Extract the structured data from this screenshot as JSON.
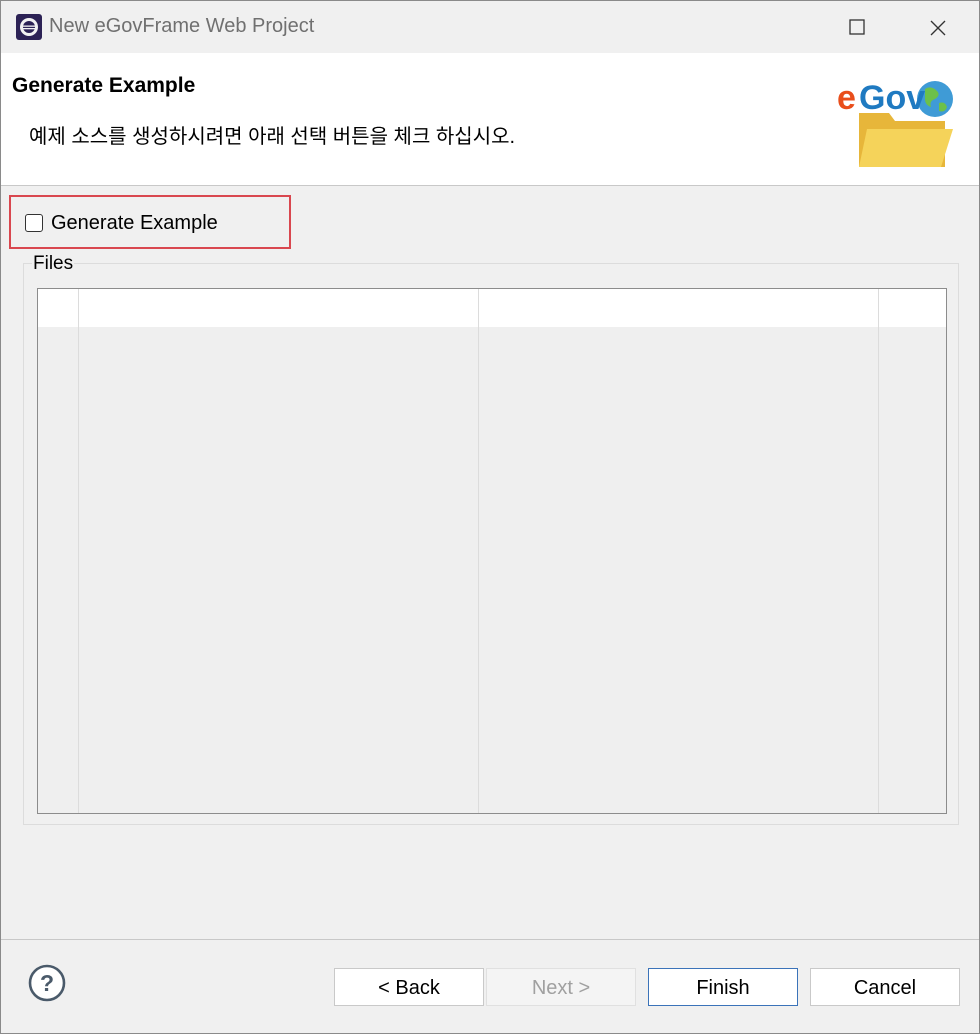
{
  "window": {
    "title": "New eGovFrame Web Project"
  },
  "header": {
    "title": "Generate Example",
    "description": "예제 소스를 생성하시려면 아래 선택 버튼을 체크 하십시오.",
    "logo_text": "eGov"
  },
  "options": {
    "generate_example": {
      "label": "Generate Example",
      "checked": false
    }
  },
  "files": {
    "group_label": "Files",
    "columns": [
      "",
      "",
      "",
      ""
    ],
    "rows": []
  },
  "footer": {
    "back_label": "< Back",
    "next_label": "Next >",
    "finish_label": "Finish",
    "cancel_label": "Cancel"
  },
  "colors": {
    "highlight_border": "#d9474f",
    "primary_button_border": "#3b73b9",
    "logo_e": "#e94e1b",
    "logo_gov": "#1f7ac1",
    "folder": "#f2c94c"
  }
}
